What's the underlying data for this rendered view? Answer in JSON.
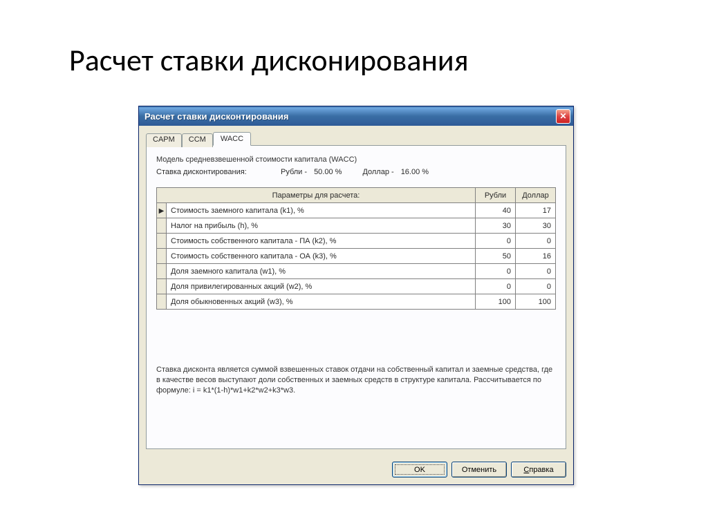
{
  "slide_title": "Расчет ставки дисконирования",
  "window": {
    "title": "Расчет ставки дисконтирования"
  },
  "tabs": {
    "capm": "CAPM",
    "ccm": "CCM",
    "wacc": "WACC"
  },
  "panel": {
    "model_label": "Модель средневзвешенной стоимости капитала (WACC)",
    "rate_label": "Ставка дисконтирования:",
    "rub_label": "Рубли -",
    "rub_value": "50.00 %",
    "usd_label": "Доллар -",
    "usd_value": "16.00 %"
  },
  "table": {
    "header_param": "Параметры для расчета:",
    "header_rub": "Рубли",
    "header_usd": "Доллар",
    "rows": [
      {
        "name": "Стоимость заемного капитала (k1), %",
        "rub": "40",
        "usd": "17",
        "current": true
      },
      {
        "name": "Налог на прибыль (h), %",
        "rub": "30",
        "usd": "30"
      },
      {
        "name": "Стоимость собственного капитала - ПА (k2), %",
        "rub": "0",
        "usd": "0"
      },
      {
        "name": "Стоимость собственного капитала - ОА (k3), %",
        "rub": "50",
        "usd": "16"
      },
      {
        "name": "Доля заемного капитала (w1), %",
        "rub": "0",
        "usd": "0"
      },
      {
        "name": "Доля привилегированных акций (w2), %",
        "rub": "0",
        "usd": "0"
      },
      {
        "name": "Доля обыкновенных акций (w3), %",
        "rub": "100",
        "usd": "100"
      }
    ]
  },
  "explanation": "Ставка дисконта является суммой взвешенных ставок отдачи на собственный капитал и заемные средства, где в качестве весов выступают доли собственных и заемных средств в структуре капитала. Рассчитывается по формуле: i = k1*(1-h)*w1+k2*w2+k3*w3.",
  "buttons": {
    "ok": "OK",
    "cancel": "Отменить",
    "help_pre": "С",
    "help_rest": "правка"
  }
}
